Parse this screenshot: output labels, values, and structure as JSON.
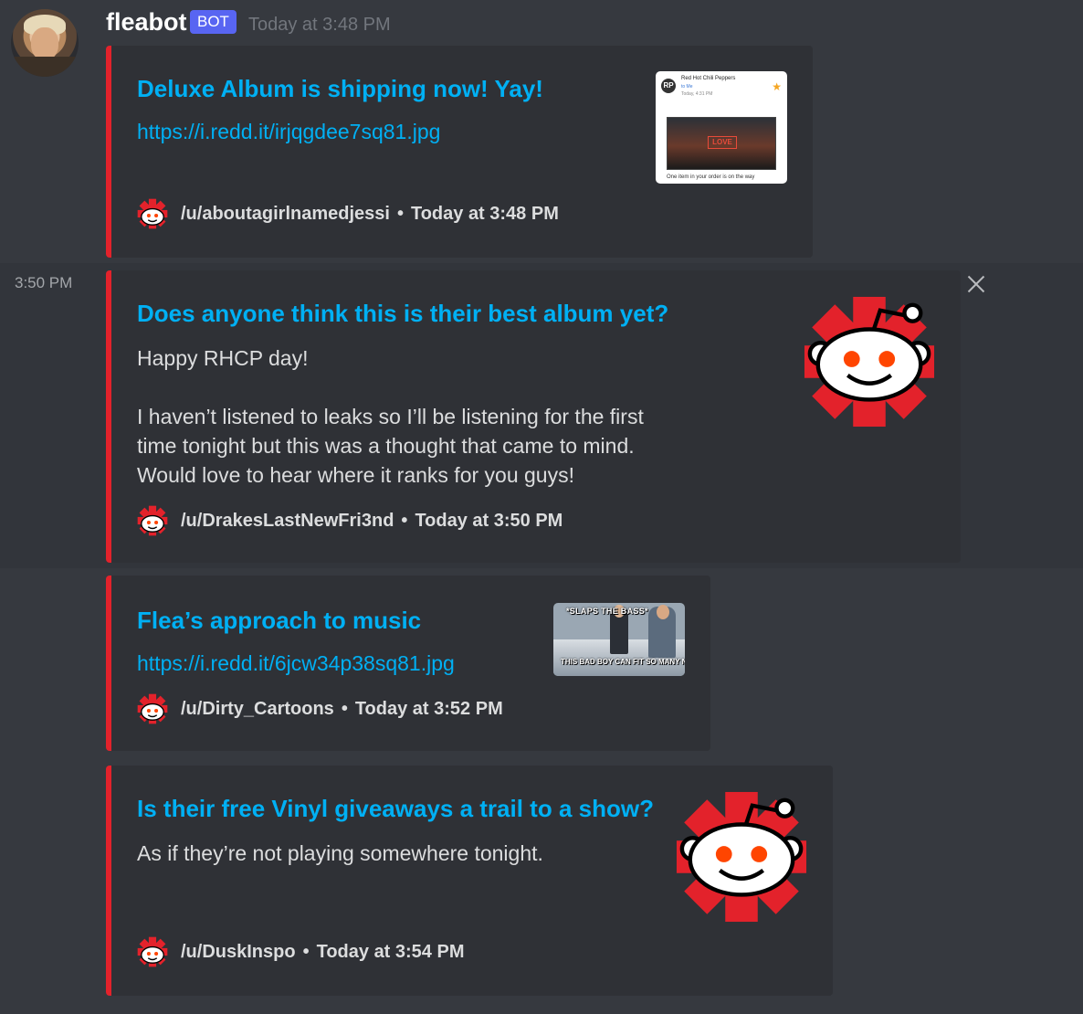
{
  "bot": {
    "name": "fleabot",
    "tag": "BOT",
    "timestamp": "Today at 3:48 PM"
  },
  "hover_timestamp": "3:50 PM",
  "colors": {
    "background": "#36393f",
    "embed_background": "#2f3136",
    "embed_border": "#e3222b",
    "link": "#00b0f4",
    "bot_tag": "#5865f2",
    "reddit_orange": "#ff4500"
  },
  "icons": {
    "footer": "reddit-snoo-icon",
    "close": "close-icon"
  },
  "embeds": [
    {
      "title": "Deluxe Album is shipping now! Yay!",
      "link": "https://i.redd.it/irjqgdee7sq81.jpg",
      "author": "/u/aboutagirlnamedjessi",
      "time": "Today at 3:48 PM",
      "thumbnail": {
        "kind": "email-screenshot",
        "from": "Red Hot Chili Peppers",
        "to": "to Me",
        "mail_time": "Today, 4:31 PM",
        "logo": "RP",
        "album_text": "LOVE",
        "footer_text": "One item in your order is on the way"
      }
    },
    {
      "title": "Does anyone think this is their best album yet?",
      "description": "Happy RHCP day!\n\nI haven’t listened to leaks so I’ll be listening for the first\ntime tonight but this was a thought that came to mind.\nWould love to hear where it ranks for you guys!",
      "author": "/u/DrakesLastNewFri3nd",
      "time": "Today at 3:50 PM",
      "thumbnail": {
        "kind": "reddit-snoo-rhcp"
      }
    },
    {
      "title": "Flea’s approach to music",
      "link": "https://i.redd.it/6jcw34p38sq81.jpg",
      "author": "/u/Dirty_Cartoons",
      "time": "Today at 3:52 PM",
      "thumbnail": {
        "kind": "meme",
        "top_text": "*SLAPS THE BASS*",
        "bottom_text": "THIS BAD BOY CAN FIT SO MANY NOTES IN IT"
      }
    },
    {
      "title": "Is their free Vinyl giveaways a trail to a show?",
      "description": "As if they’re not playing somewhere tonight.",
      "author": "/u/DuskInspo",
      "time": "Today at 3:54 PM",
      "thumbnail": {
        "kind": "reddit-snoo-rhcp"
      }
    }
  ],
  "separator": "•"
}
